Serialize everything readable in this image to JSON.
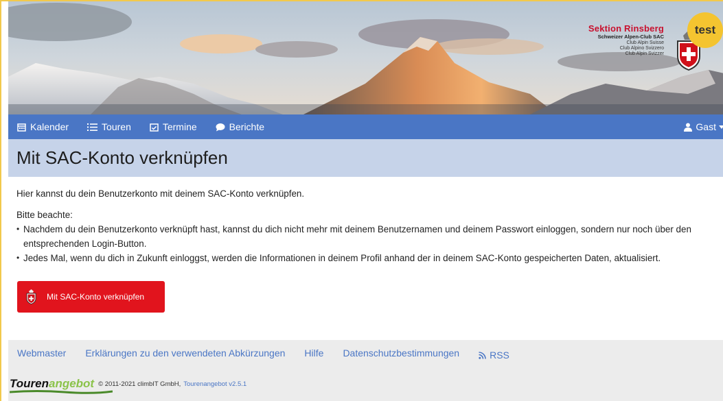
{
  "header": {
    "section_title": "Sektion Rinsberg",
    "section_lines": [
      "Schweizer Alpen-Club SAC",
      "Club Alpin Suisse",
      "Club Alpino Svizzero",
      "Club Alpin Svizzer"
    ],
    "badge": "test"
  },
  "nav": {
    "items": [
      {
        "label": "Kalender",
        "icon": "calendar-icon"
      },
      {
        "label": "Touren",
        "icon": "list-icon"
      },
      {
        "label": "Termine",
        "icon": "calendar-check-icon"
      },
      {
        "label": "Berichte",
        "icon": "comment-icon"
      }
    ],
    "user_label": "Gast"
  },
  "page": {
    "title": "Mit SAC-Konto verknüpfen",
    "intro": "Hier kannst du dein Benutzerkonto mit deinem SAC-Konto verknüpfen.",
    "note_label": "Bitte beachte:",
    "bullets": [
      "Nachdem du dein Benutzerkonto verknüpft hast, kannst du dich nicht mehr mit deinem Benutzernamen und deinem Passwort einloggen, sondern nur noch über den entsprechenden Login-Button.",
      "Jedes Mal, wenn du dich in Zukunft einloggst, werden die Informationen in deinem Profil anhand der in deinem SAC-Konto gespeicherten Daten, aktualisiert."
    ],
    "button_label": "Mit SAC-Konto verknüpfen"
  },
  "footer": {
    "links": [
      "Webmaster",
      "Erklärungen zu den verwendeten Abkürzungen",
      "Hilfe",
      "Datenschutzbestimmungen",
      "RSS"
    ],
    "logo_part1": "Touren",
    "logo_part2": "angebot",
    "copyright": "© 2011-2021 climbIT GmbH,",
    "version_link": "Tourenangebot v2.5.1"
  },
  "colors": {
    "nav": "#4a76c5",
    "title_band": "#c6d3e9",
    "button": "#e1141d",
    "badge": "#f4c430",
    "brand_red": "#c8102e"
  }
}
